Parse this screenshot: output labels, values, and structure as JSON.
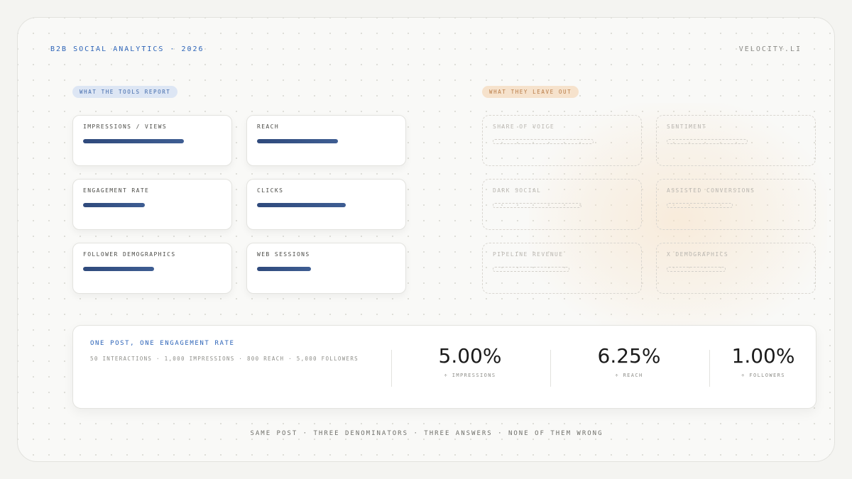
{
  "header": {
    "title": "B2B SOCIAL ANALYTICS · 2026",
    "brand": "VELOCITY.LI"
  },
  "reported": {
    "tag": "WHAT THE TOOLS REPORT",
    "items": [
      {
        "label": "IMPRESSIONS / VIEWS",
        "bar_fill": 0.67
      },
      {
        "label": "REACH",
        "bar_fill": 0.54
      },
      {
        "label": "ENGAGEMENT RATE",
        "bar_fill": 0.41
      },
      {
        "label": "CLICKS",
        "bar_fill": 0.59
      },
      {
        "label": "FOLLOWER DEMOGRAPHICS",
        "bar_fill": 0.47
      },
      {
        "label": "WEB SESSIONS",
        "bar_fill": 0.36
      }
    ]
  },
  "missing": {
    "tag": "WHAT THEY LEAVE OUT",
    "items": [
      {
        "label": "SHARE OF VOICE",
        "bar_fill": 0.67
      },
      {
        "label": "SENTIMENT",
        "bar_fill": 0.54
      },
      {
        "label": "DARK SOCIAL",
        "bar_fill": 0.59
      },
      {
        "label": "ASSISTED CONVERSIONS",
        "bar_fill": 0.44
      },
      {
        "label": "PIPELINE REVENUE",
        "bar_fill": 0.51
      },
      {
        "label": "X DEMOGRAPHICS",
        "bar_fill": 0.39
      }
    ]
  },
  "example": {
    "title": "ONE POST, ONE ENGAGEMENT RATE",
    "subtitle": "50 INTERACTIONS · 1,000 IMPRESSIONS · 800 REACH · 5,000 FOLLOWERS",
    "metrics": [
      {
        "value": "5.00%",
        "caption": "÷ IMPRESSIONS"
      },
      {
        "value": "6.25%",
        "caption": "÷ REACH"
      },
      {
        "value": "1.00%",
        "caption": "÷ FOLLOWERS"
      }
    ]
  },
  "footer": "SAME POST · THREE DENOMINATORS · THREE ANSWERS · NONE OF THEM WRONG",
  "colors": {
    "accent_blue": "#2d64b8",
    "bar_navy": "#2f4a7c",
    "accent_orange": "#b77a44"
  }
}
